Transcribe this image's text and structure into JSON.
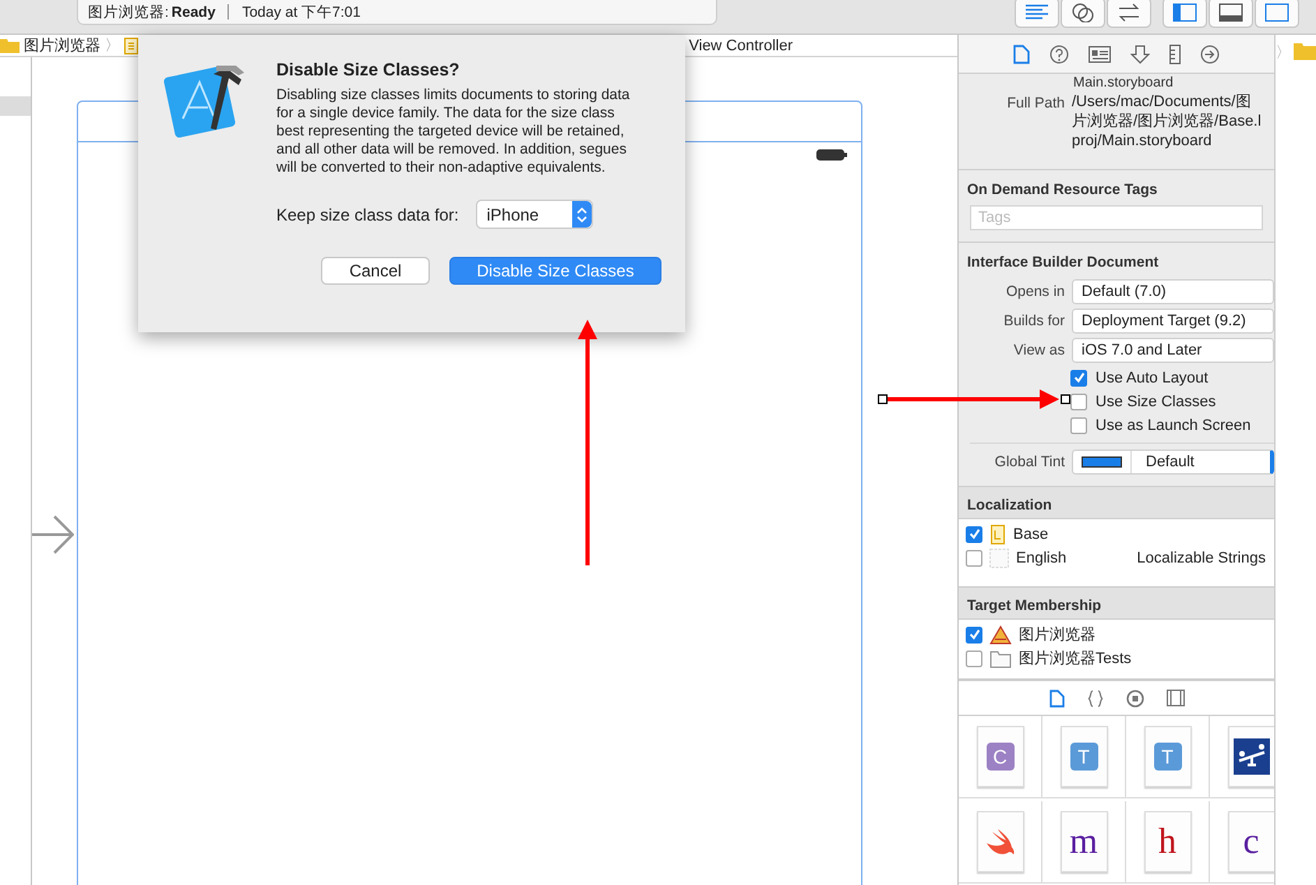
{
  "toolbar": {
    "project": "图片浏览器:",
    "status": "Ready",
    "time": "Today at 下午7:01"
  },
  "breadcrumb": {
    "project": "图片浏览器",
    "separator": "〉",
    "tail": "View Controller"
  },
  "dialog": {
    "title": "Disable Size Classes?",
    "message": "Disabling size classes limits documents to storing data for a single device family. The data for the size class best representing the targeted device will be retained, and all other data will be removed. In addition, segues will be converted to their non-adaptive equivalents.",
    "keep_label": "Keep size class data for:",
    "device": "iPhone",
    "buttons": [
      {
        "label": "Cancel",
        "kind": "default"
      },
      {
        "label": "Disable Size Classes",
        "kind": "primary"
      }
    ]
  },
  "inspector": {
    "tabs": [
      {
        "selected": true
      },
      {
        "selected": false
      },
      {
        "selected": false
      },
      {
        "selected": false
      },
      {
        "selected": false
      },
      {
        "selected": false
      }
    ],
    "file_name": "Main.storyboard",
    "full_path_label": "Full Path",
    "full_path": "/Users/mac/Documents/图片浏览器/图片浏览器/Base.lproj/Main.storyboard",
    "tags_title": "On Demand Resource Tags",
    "tags_placeholder": "Tags",
    "ib_title": "Interface Builder Document",
    "fields": [
      {
        "label": "Opens in",
        "value": "Default (7.0)"
      },
      {
        "label": "Builds for",
        "value": "Deployment Target (9.2)"
      },
      {
        "label": "View as",
        "value": "iOS 7.0 and Later"
      }
    ],
    "options": [
      {
        "label": "Use Auto Layout",
        "checked": true
      },
      {
        "label": "Use Size Classes",
        "checked": false
      },
      {
        "label": "Use as Launch Screen",
        "checked": false
      }
    ],
    "tint_label": "Global Tint",
    "tint_value": "Default",
    "localization_title": "Localization",
    "localizations": [
      {
        "name": "Base",
        "checked": true,
        "kind": "base"
      },
      {
        "name": "English",
        "checked": false,
        "kind": "blank",
        "detail": "Localizable Strings"
      }
    ],
    "membership_title": "Target Membership",
    "targets": [
      {
        "name": "图片浏览器",
        "checked": true,
        "kind": "app"
      },
      {
        "name": "图片浏览器Tests",
        "checked": false,
        "kind": "folder"
      }
    ]
  },
  "library": {
    "tabs": [
      {
        "selected": true
      },
      {
        "selected": false
      },
      {
        "selected": false
      },
      {
        "selected": false
      }
    ],
    "items": [
      {
        "kind": "badge",
        "glyph": "C",
        "color": "#9c82c4"
      },
      {
        "kind": "badge",
        "glyph": "T",
        "color": "#5b9ad8"
      },
      {
        "kind": "badge",
        "glyph": "T",
        "color": "#5b9ad8"
      },
      {
        "kind": "image"
      },
      {
        "kind": "swift"
      },
      {
        "kind": "letter",
        "glyph": "m",
        "color": "#5a1fa0"
      },
      {
        "kind": "letter",
        "glyph": "h",
        "color": "#c0141c"
      },
      {
        "kind": "letter",
        "glyph": "c",
        "color": "#5a1fa0"
      }
    ]
  }
}
